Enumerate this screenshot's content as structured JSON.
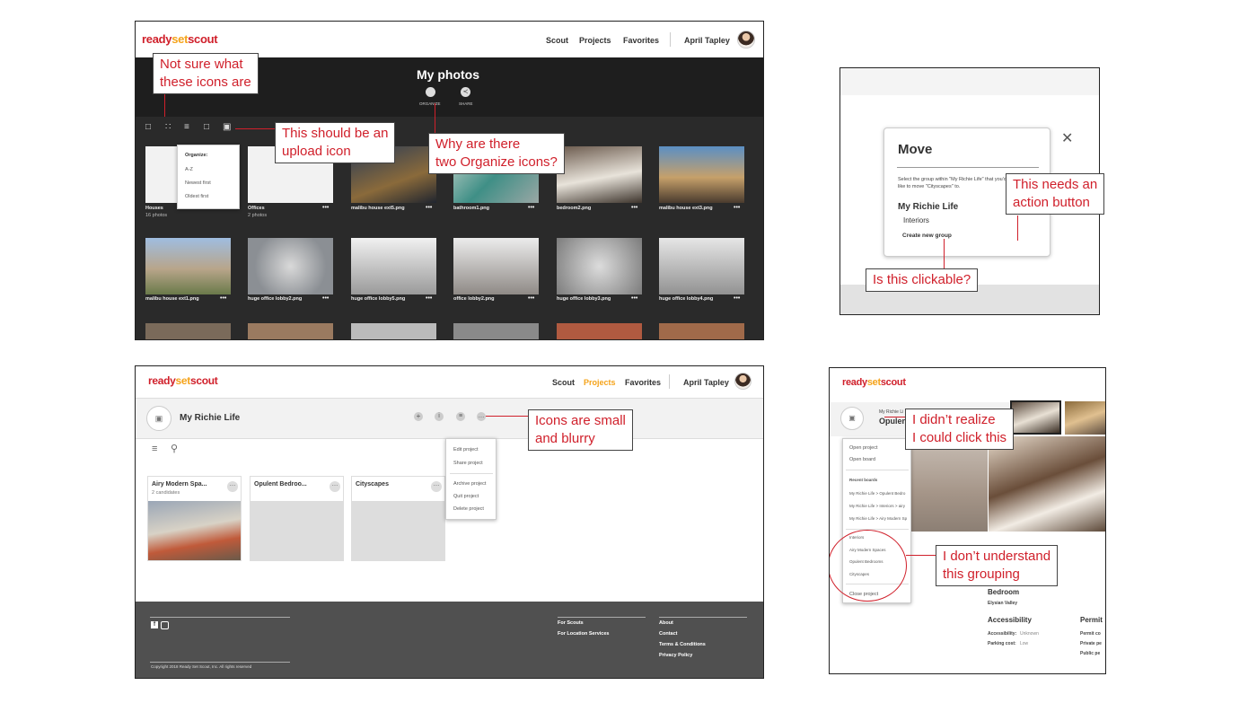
{
  "brand": {
    "ready": "ready",
    "set": "set",
    "scout": "scout"
  },
  "nav": {
    "scout": "Scout",
    "projects": "Projects",
    "favorites": "Favorites",
    "user": "April Tapley"
  },
  "panel1": {
    "title": "My photos",
    "actions": [
      {
        "label": "ORGANIZE"
      },
      {
        "label": "SHARE"
      }
    ],
    "organize_menu": {
      "header": "Organize:",
      "items": [
        "A-Z",
        "Newest first",
        "Oldest first"
      ]
    },
    "folders": [
      {
        "name": "Houses",
        "count": "16 photos"
      },
      {
        "name": "Offices",
        "count": "2 photos"
      }
    ],
    "photos_row1": [
      "malibu house ext5.png",
      "bathroom1.png",
      "bedroom2.png",
      "malibu house ext3.png"
    ],
    "photos_row2": [
      "malibu house ext1.png",
      "huge office lobby2.png",
      "huge office lobby5.png",
      "office lobby2.png",
      "huge office lobby3.png",
      "huge office lobby4.png"
    ],
    "more": "•••"
  },
  "panel2": {
    "title": "Move",
    "desc1": "Select the group within \"My Richie Life\" that you'd",
    "desc2": "like to move \"Cityscapes\" to.",
    "group": "My Richie Life",
    "sub": "Interiors",
    "create": "Create new group",
    "close": "✕"
  },
  "panel3": {
    "project": "My Richie Life",
    "menu": [
      "Edit project",
      "Share project",
      "Archive project",
      "Quit project",
      "Delete project"
    ],
    "cards": [
      {
        "title": "Airy Modern Spa...",
        "sub": "2 candidates"
      },
      {
        "title": "Opulent Bedroo...",
        "sub": ""
      },
      {
        "title": "Cityscapes",
        "sub": ""
      }
    ],
    "footer": {
      "col1": [
        "For Scouts",
        "For Location Services"
      ],
      "col2": [
        "About",
        "Contact",
        "Terms & Conditions",
        "Privacy Policy"
      ],
      "copyright": "Copyright 2018 Ready Set Scout, Inc. All rights reserved"
    }
  },
  "panel4": {
    "crumb": "My Richie Li",
    "title": "Opulen",
    "menu1": [
      "Open project",
      "Open board"
    ],
    "recent_header": "Recent boards",
    "recent": [
      "My Richie Life > Opulent Bedro",
      "My Richie Life > Interiors > airy",
      "My Richie Life > Airy Modern Sp"
    ],
    "groups": [
      "Interiors",
      "Airy Modern Spaces",
      "Opulent Bedrooms",
      "Cityscapes"
    ],
    "close_project": "Close project",
    "detail": {
      "room": "Bedroom",
      "location": "Elysian Valley",
      "access_h": "Accessibility",
      "access1_k": "Accessibility:",
      "access1_v": "Unknown",
      "access2_k": "Parking cost:",
      "access2_v": "Low",
      "permit_h": "Permit",
      "permit1": "Permit co",
      "permit2": "Private pe",
      "permit3": "Public pe"
    }
  },
  "annotations": {
    "a1": "Not sure what\nthese icons are",
    "a2": "This should be an\nupload icon",
    "a3": "Why are there\ntwo Organize icons?",
    "a4": "This needs an\naction button",
    "a5": "Is this clickable?",
    "a6": "Icons are small\nand blurry",
    "a7": "I didn’t realize\nI could click this",
    "a8": "I don’t understand\nthis grouping"
  },
  "colors": {
    "accent": "#d0202b",
    "brand_set": "#f5a31a",
    "dark_bg": "#1e1e1e",
    "footer_bg": "#505050"
  }
}
